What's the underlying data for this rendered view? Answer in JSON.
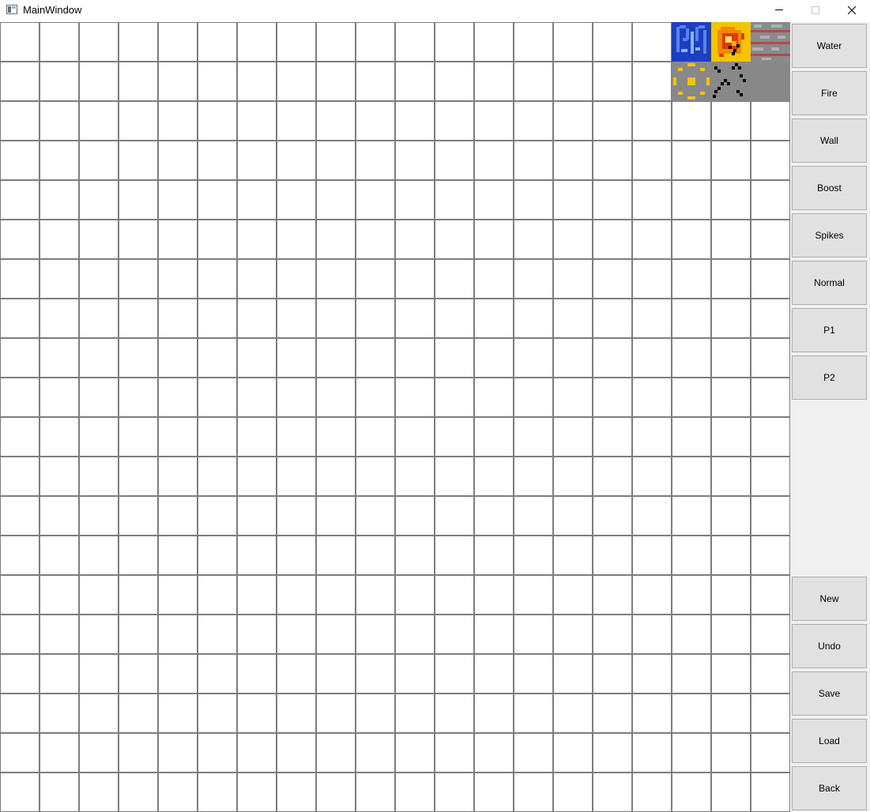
{
  "window": {
    "title": "MainWindow",
    "controls": [
      "minimize",
      "maximize",
      "close"
    ]
  },
  "board": {
    "columns": 20,
    "rows": 20,
    "placed_tiles": [
      {
        "row": 0,
        "col": 17,
        "type": "Water",
        "icon": "water-tile-icon"
      },
      {
        "row": 0,
        "col": 18,
        "type": "Fire",
        "icon": "fire-tile-icon"
      },
      {
        "row": 0,
        "col": 19,
        "type": "Wall",
        "icon": "wall-tile-icon"
      },
      {
        "row": 1,
        "col": 17,
        "type": "Boost",
        "icon": "boost-tile-icon"
      },
      {
        "row": 1,
        "col": 18,
        "type": "Spikes",
        "icon": "spikes-tile-icon"
      },
      {
        "row": 1,
        "col": 19,
        "type": "Normal",
        "icon": "normal-tile-icon"
      }
    ],
    "colors": {
      "grid_line": "#7d7d7d",
      "water": "#1a3fc2",
      "fire": "#f5c400",
      "wall": "#8a8a8a",
      "stone": "#888888"
    }
  },
  "tools": {
    "water": "Water",
    "fire": "Fire",
    "wall": "Wall",
    "boost": "Boost",
    "spikes": "Spikes",
    "normal": "Normal",
    "p1": "P1",
    "p2": "P2"
  },
  "actions": {
    "new": "New",
    "undo": "Undo",
    "save": "Save",
    "load": "Load",
    "back": "Back"
  }
}
